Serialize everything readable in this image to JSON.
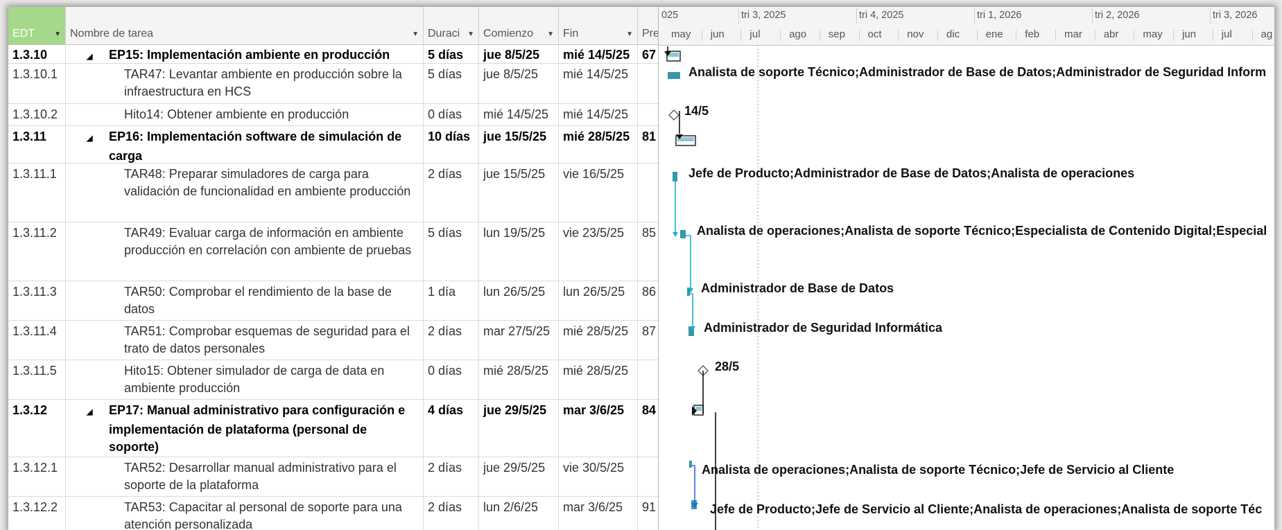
{
  "grid": {
    "headers": {
      "edt": "EDT",
      "name": "Nombre de tarea",
      "duration": "Duraci",
      "start": "Comienzo",
      "finish": "Fin",
      "pred": "Pred"
    },
    "rows": [
      {
        "edt": "1.3.10",
        "name": "EP15: Implementación ambiente en producción",
        "duration": "5 días",
        "start": "jue 8/5/25",
        "finish": "mié 14/5/25",
        "pred": "67",
        "summary": true
      },
      {
        "edt": "1.3.10.1",
        "name": "TAR47: Levantar ambiente en producción sobre la infraestructura en HCS",
        "duration": "5 días",
        "start": "jue 8/5/25",
        "finish": "mié 14/5/25",
        "pred": "",
        "summary": false
      },
      {
        "edt": "1.3.10.2",
        "name": "Hito14: Obtener ambiente en producción",
        "duration": "0 días",
        "start": "mié 14/5/25",
        "finish": "mié 14/5/25",
        "pred": "",
        "summary": false
      },
      {
        "edt": "1.3.11",
        "name": "EP16: Implementación software de simulación de carga",
        "duration": "10 días",
        "start": "jue 15/5/25",
        "finish": "mié 28/5/25",
        "pred": "81",
        "summary": true
      },
      {
        "edt": "1.3.11.1",
        "name": "TAR48: Preparar simuladores de carga para validación de funcionalidad en ambiente producción",
        "duration": "2 días",
        "start": "jue 15/5/25",
        "finish": "vie 16/5/25",
        "pred": "",
        "summary": false
      },
      {
        "edt": "1.3.11.2",
        "name": "TAR49: Evaluar carga de información en ambiente producción en correlación con ambiente de pruebas",
        "duration": "5 días",
        "start": "lun 19/5/25",
        "finish": "vie 23/5/25",
        "pred": "85",
        "summary": false
      },
      {
        "edt": "1.3.11.3",
        "name": "TAR50: Comprobar el rendimiento de la base de datos",
        "duration": "1 día",
        "start": "lun 26/5/25",
        "finish": "lun 26/5/25",
        "pred": "86",
        "summary": false
      },
      {
        "edt": "1.3.11.4",
        "name": "TAR51: Comprobar esquemas de seguridad para el trato de datos personales",
        "duration": "2 días",
        "start": "mar 27/5/25",
        "finish": "mié 28/5/25",
        "pred": "87",
        "summary": false
      },
      {
        "edt": "1.3.11.5",
        "name": "Hito15: Obtener simulador de carga de data en ambiente producción",
        "duration": "0 días",
        "start": "mié 28/5/25",
        "finish": "mié 28/5/25",
        "pred": "",
        "summary": false
      },
      {
        "edt": "1.3.12",
        "name": "EP17: Manual administrativo para configuración e implementación de plataforma (personal de soporte)",
        "duration": "4 días",
        "start": "jue 29/5/25",
        "finish": "mar 3/6/25",
        "pred": "84",
        "summary": true
      },
      {
        "edt": "1.3.12.1",
        "name": "TAR52: Desarrollar manual administrativo para el soporte de la plataforma",
        "duration": "2 días",
        "start": "jue 29/5/25",
        "finish": "vie 30/5/25",
        "pred": "",
        "summary": false
      },
      {
        "edt": "1.3.12.2",
        "name": "TAR53: Capacitar al personal de soporte para una atención personalizada",
        "duration": "2 días",
        "start": "lun 2/6/25",
        "finish": "mar 3/6/25",
        "pred": "91",
        "summary": false
      }
    ]
  },
  "timescale": {
    "quarters": [
      "025",
      "tri 3, 2025",
      "tri 4, 2025",
      "tri 1, 2026",
      "tri 2, 2026",
      "tri 3, 2026"
    ],
    "months": [
      "may",
      "jun",
      "jul",
      "ago",
      "sep",
      "oct",
      "nov",
      "dic",
      "ene",
      "feb",
      "mar",
      "abr",
      "may",
      "jun",
      "jul",
      "ag"
    ]
  },
  "gantt": {
    "resources": [
      "Analista de soporte Técnico;Administrador de Base de Datos;Administrador de Seguridad Inform",
      "Jefe de Producto;Administrador de Base de Datos;Analista de operaciones",
      "Analista de operaciones;Analista de soporte Técnico;Especialista de Contenido Digital;Especial",
      "Administrador de Base de Datos",
      "Administrador de Seguridad Informática",
      "Analista de operaciones;Analista de soporte Técnico;Jefe de Servicio al Cliente",
      "Jefe de Producto;Jefe de Servicio al Cliente;Analista de operaciones;Analista de soporte Téc"
    ],
    "milestones": [
      "14/5",
      "28/5"
    ],
    "colors": {
      "bar": "#3a96a8",
      "summary": "#5a5a5a",
      "link": "#1ab0c8",
      "link_dark": "#111111"
    }
  }
}
